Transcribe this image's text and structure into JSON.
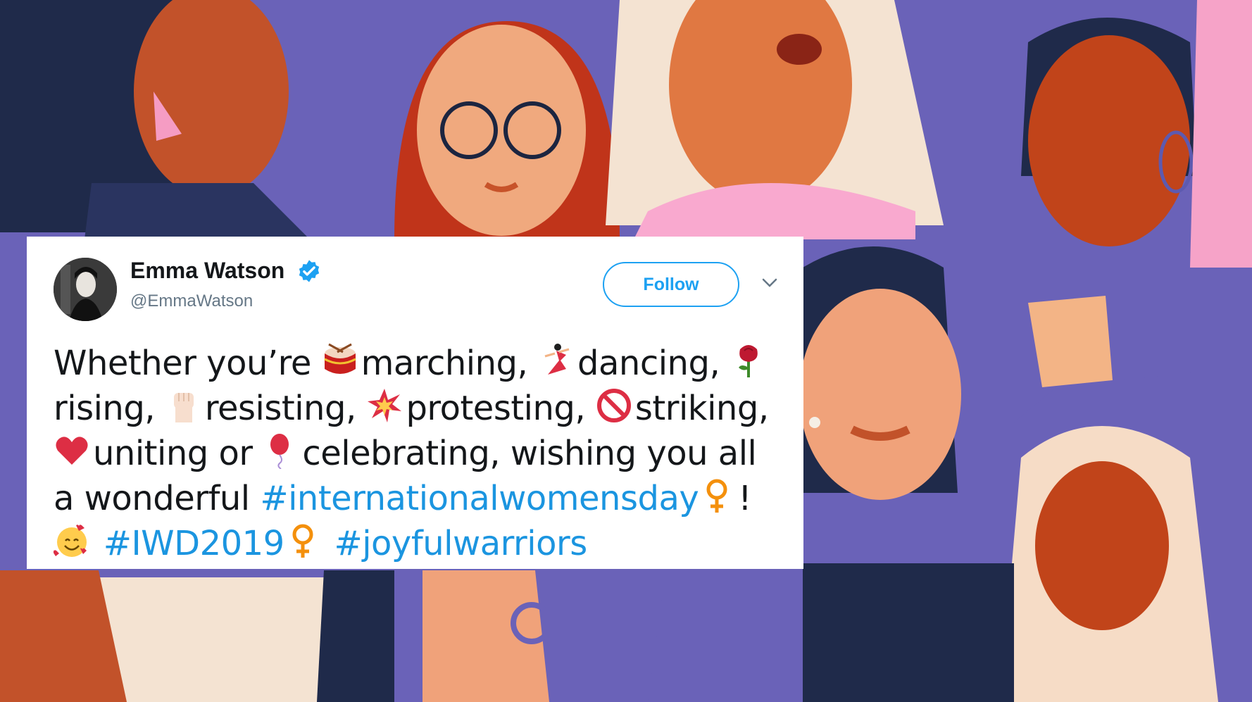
{
  "tweet": {
    "display_name": "Emma Watson",
    "handle": "@EmmaWatson",
    "follow_label": "Follow",
    "text": {
      "s1": "Whether you’re ",
      "s2": "marching, ",
      "s3": "dancing, ",
      "s4": "rising, ",
      "s5": "resisting, ",
      "s6": "protesting, ",
      "s7": "striking, ",
      "s8": "uniting or ",
      "s9": "celebrating, wishing you all a wonderful ",
      "h1": "#internationalwomensday",
      "s10": "! ",
      "h2": "#IWD2019",
      "h3": "#joyfulwarriors"
    }
  },
  "colors": {
    "background": "#6a62b8",
    "link": "#1b95e0",
    "follow": "#1da1f2",
    "verified": "#1da1f2"
  },
  "icons": [
    "verified-badge-icon",
    "chevron-down-icon",
    "drum-icon",
    "dancer-icon",
    "rose-icon",
    "raised-fist-icon",
    "collision-icon",
    "prohibited-icon",
    "red-heart-icon",
    "balloon-icon",
    "female-sign-icon",
    "smiling-face-with-hearts-icon"
  ]
}
